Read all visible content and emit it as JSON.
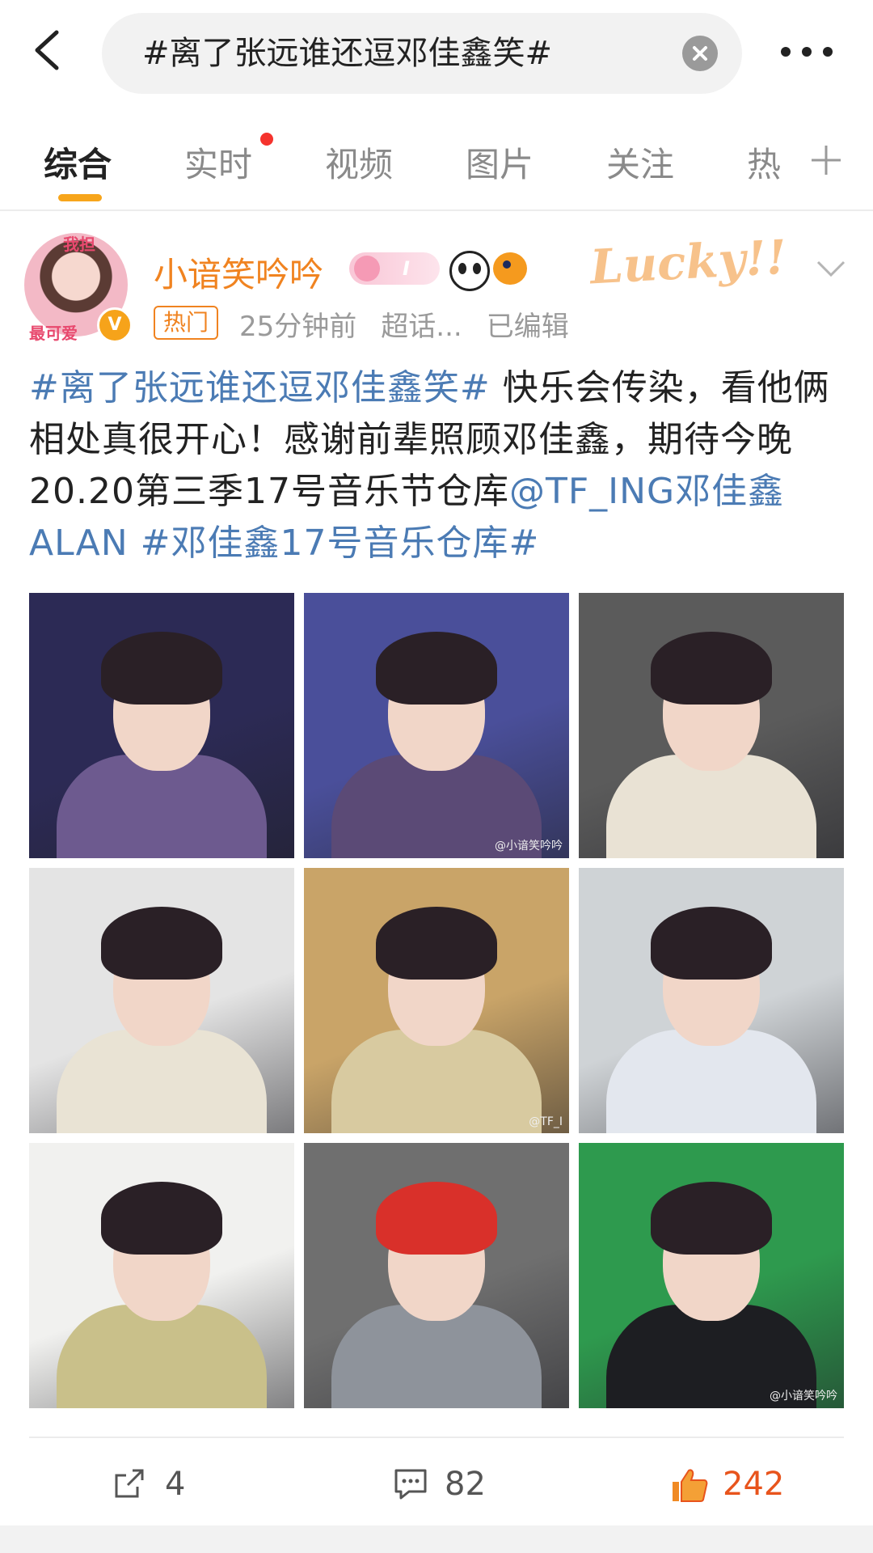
{
  "search": {
    "query": "#离了张远谁还逗邓佳鑫笑#"
  },
  "tabs": [
    {
      "label": "综合",
      "active": true
    },
    {
      "label": "实时",
      "active": false,
      "dot": true
    },
    {
      "label": "视频",
      "active": false
    },
    {
      "label": "图片",
      "active": false
    },
    {
      "label": "关注",
      "active": false
    },
    {
      "label": "热",
      "active": false
    }
  ],
  "post": {
    "author": "小谙笑吟吟",
    "avatar_frame_top": "我担",
    "avatar_frame_bottom": "最可爱",
    "badge_text": "I",
    "decor_text": "Lucky!!",
    "hot_tag": "热门",
    "time": "25分钟前",
    "source": "超话...",
    "edited": "已编辑",
    "text": {
      "topic1": "#离了张远谁还逗邓佳鑫笑#",
      "body": " 快乐会传染，看他俩相处真很开心！感谢前辈照顾邓佳鑫，期待今晚20.20第三季17号音乐节仓库",
      "mention": "@TF_ING邓佳鑫ALAN",
      "space": " ",
      "topic2": "#邓佳鑫17号音乐仓库#"
    },
    "images": [
      {
        "desc": "stage-purple-jacket-mic",
        "bg": "#2c2a55",
        "accent": "#6d5a8f"
      },
      {
        "desc": "stage-closeup-glasses-mic",
        "bg": "#4a4f9a",
        "accent": "#5b4a76",
        "watermark": "@小谙笑吟吟"
      },
      {
        "desc": "white-shirt-portrait",
        "bg": "#5b5b5b",
        "accent": "#e9e2d4"
      },
      {
        "desc": "v-neck-sweater-portrait",
        "bg": "#e4e4e4",
        "accent": "#e9e3d4"
      },
      {
        "desc": "yellow-jacket-reading",
        "bg": "#c9a468",
        "accent": "#d8caa0",
        "watermark": "@TF_I"
      },
      {
        "desc": "airport-black-mask",
        "bg": "#cfd3d6",
        "accent": "#e3e7ee"
      },
      {
        "desc": "library-yellow-hoodie",
        "bg": "#f1f1ef",
        "accent": "#c9c08a"
      },
      {
        "desc": "red-lobster-hat-mic",
        "bg": "#6f6f6f",
        "accent": "#8e939b"
      },
      {
        "desc": "black-jacket-green-wall",
        "bg": "#2e9a4e",
        "accent": "#1d1e22",
        "watermark": "@小谙笑吟吟"
      }
    ],
    "actions": {
      "repost": "4",
      "comment": "82",
      "like": "242"
    }
  },
  "colors": {
    "accent": "#f7a51b",
    "username": "#f08320",
    "link": "#4b7bb4",
    "like": "#e8541c"
  }
}
